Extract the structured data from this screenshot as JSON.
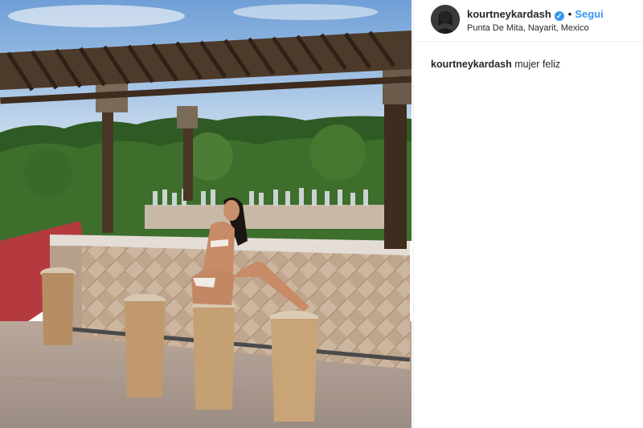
{
  "post": {
    "username": "kourtneykardash",
    "verified_icon": "verified-badge-icon",
    "separator": "•",
    "follow_label": "Segui",
    "location": "Punta De Mita, Nayarit, Mexico",
    "caption_username": "kourtneykardash",
    "caption_text": "mujer feliz"
  },
  "colors": {
    "accent": "#3897f0",
    "text": "#262626",
    "border": "#efefef"
  }
}
